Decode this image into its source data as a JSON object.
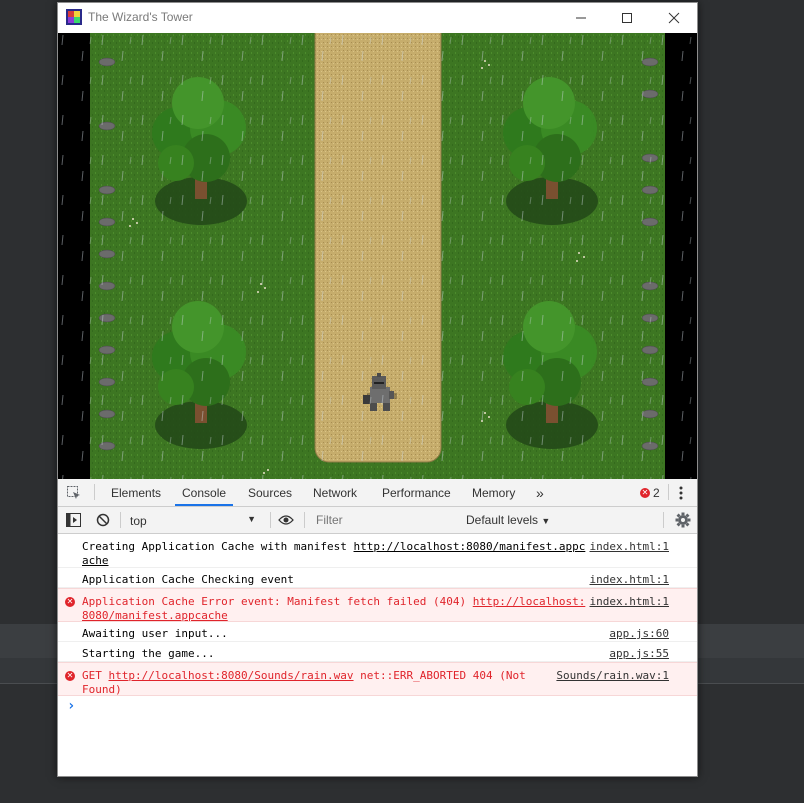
{
  "window": {
    "title": "The Wizard's Tower"
  },
  "devtools": {
    "tabs": [
      "Elements",
      "Console",
      "Sources",
      "Network",
      "Performance",
      "Memory"
    ],
    "more_tabs": "»",
    "error_count": "2",
    "context": "top",
    "filter_placeholder": "Filter",
    "levels": "Default levels"
  },
  "console": {
    "rows": [
      {
        "msg1": "Creating Application Cache with manifest ",
        "link1": "http://localhost:8080/manifest.appc",
        "msg2": "ache",
        "source": "index.html:1"
      },
      {
        "msg1": "Application Cache Checking event",
        "source": "index.html:1"
      },
      {
        "msg1": "Application Cache Error event: Manifest fetch failed (404) ",
        "link1": "http://localhost:",
        "msg2": "8080/manifest.appcache",
        "source": "index.html:1"
      },
      {
        "msg1": "Awaiting user input...",
        "source": "app.js:60"
      },
      {
        "msg1": "Starting the game...",
        "source": "app.js:55"
      },
      {
        "msg1": "GET ",
        "link1": "http://localhost:8080/Sounds/rain.wav",
        "msg1b": " net::ERR_ABORTED 404 (Not",
        "msg2": "Found)",
        "source": "Sounds/rain.wav:1"
      }
    ],
    "prompt": "›"
  },
  "colors": {
    "grass": "#3f7a22",
    "path": "#c9b06f",
    "accent": "#1a73e8",
    "error": "#e0242b"
  }
}
